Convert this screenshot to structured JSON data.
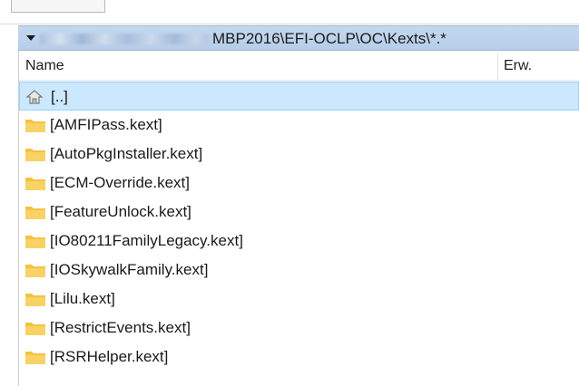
{
  "path_bar": {
    "path_text": "MBP2016\\EFI-OCLP\\OC\\Kexts\\*.*"
  },
  "columns": {
    "name": "Name",
    "extension": "Erw."
  },
  "parent_entry": {
    "label": "[..]",
    "icon": "up-folder-icon"
  },
  "folders": [
    {
      "label": "[AMFIPass.kext]",
      "icon": "folder-icon"
    },
    {
      "label": "[AutoPkgInstaller.kext]",
      "icon": "folder-icon"
    },
    {
      "label": "[ECM-Override.kext]",
      "icon": "folder-icon"
    },
    {
      "label": "[FeatureUnlock.kext]",
      "icon": "folder-icon"
    },
    {
      "label": "[IO80211FamilyLegacy.kext]",
      "icon": "folder-icon"
    },
    {
      "label": "[IOSkywalkFamily.kext]",
      "icon": "folder-icon"
    },
    {
      "label": "[Lilu.kext]",
      "icon": "folder-icon"
    },
    {
      "label": "[RestrictEvents.kext]",
      "icon": "folder-icon"
    },
    {
      "label": "[RSRHelper.kext]",
      "icon": "folder-icon"
    }
  ],
  "colors": {
    "selection": "#cce8ff",
    "path_bar": "#bcd2eb",
    "folder": "#f5c242"
  }
}
